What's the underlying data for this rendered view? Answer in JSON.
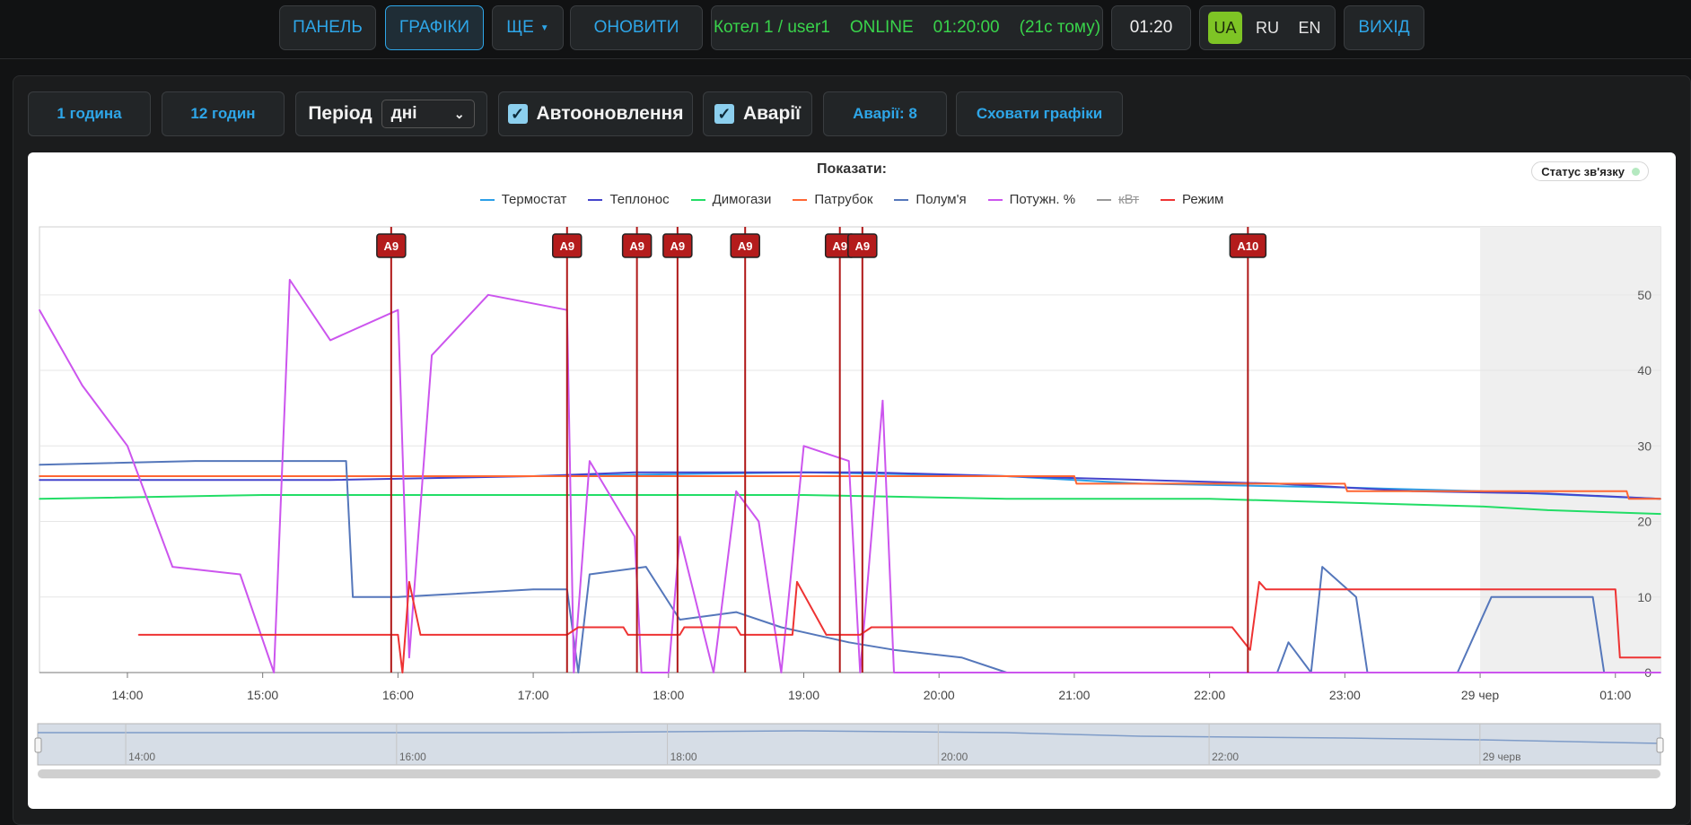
{
  "topbar": {
    "panel": "ПАНЕЛЬ",
    "charts": "ГРАФІКИ",
    "more": "ЩЕ",
    "refresh": "ОНОВИТИ",
    "status_device": "Котел 1 / user1",
    "status_state": "ONLINE",
    "status_time": "01:20:00",
    "status_ago": "(21с тому)",
    "clock": "01:20",
    "langs": [
      "UA",
      "RU",
      "EN"
    ],
    "active_lang": "UA",
    "exit": "ВИХІД"
  },
  "toolbar": {
    "one_hour": "1 година",
    "twelve_hours": "12 годин",
    "period_label": "Період",
    "period_value": "дні",
    "autorefresh": "Автооновлення",
    "alarms_toggle": "Аварії",
    "alarms_count": "Аварії: 8",
    "hide_charts": "Сховати графіки"
  },
  "chart_header": {
    "show": "Показати:",
    "link_status": "Статус зв'язку"
  },
  "chart_data": {
    "type": "line",
    "x_unit": "time",
    "xlim": [
      "13:21",
      "01:20"
    ],
    "ylim": [
      0,
      59
    ],
    "y_ticks": [
      0,
      10,
      20,
      30,
      40,
      50
    ],
    "x_ticks": [
      "14:00",
      "15:00",
      "16:00",
      "17:00",
      "18:00",
      "19:00",
      "20:00",
      "21:00",
      "22:00",
      "23:00",
      "29 чер",
      "01:00"
    ],
    "grid": true,
    "legend_position": "top-center",
    "shaded_region": [
      "00:00",
      "01:20"
    ],
    "series": [
      {
        "name": "Термостат",
        "color": "#2b9fe8",
        "visible": true,
        "points": [
          [
            "13:21",
            26
          ],
          [
            "15:30",
            26
          ],
          [
            "17:00",
            26
          ],
          [
            "19:00",
            26.5
          ],
          [
            "20:30",
            26
          ],
          [
            "21:30",
            25
          ],
          [
            "23:00",
            24.5
          ],
          [
            "00:00",
            24
          ],
          [
            "01:20",
            23
          ]
        ]
      },
      {
        "name": "Теплонос",
        "color": "#4444cc",
        "visible": true,
        "points": [
          [
            "13:21",
            25.5
          ],
          [
            "15:30",
            25.5
          ],
          [
            "17:00",
            26
          ],
          [
            "17:45",
            26.5
          ],
          [
            "19:30",
            26.5
          ],
          [
            "20:30",
            26
          ],
          [
            "21:30",
            25.5
          ],
          [
            "22:30",
            25
          ],
          [
            "23:30",
            24
          ],
          [
            "00:30",
            23.7
          ],
          [
            "01:20",
            23
          ]
        ]
      },
      {
        "name": "Димогази",
        "color": "#22dd66",
        "visible": true,
        "points": [
          [
            "13:21",
            23
          ],
          [
            "15:00",
            23.5
          ],
          [
            "17:00",
            23.5
          ],
          [
            "19:00",
            23.5
          ],
          [
            "20:30",
            23
          ],
          [
            "22:00",
            23
          ],
          [
            "23:00",
            22.5
          ],
          [
            "00:00",
            22
          ],
          [
            "00:30",
            21.5
          ],
          [
            "01:20",
            21
          ]
        ]
      },
      {
        "name": "Патрубок",
        "color": "#ff6633",
        "visible": true,
        "points": [
          [
            "13:21",
            26
          ],
          [
            "16:00",
            26
          ],
          [
            "19:00",
            26
          ],
          [
            "21:00",
            26
          ],
          [
            "21:01",
            25
          ],
          [
            "22:00",
            25
          ],
          [
            "23:00",
            25
          ],
          [
            "23:01",
            24
          ],
          [
            "00:30",
            24
          ],
          [
            "01:05",
            24
          ],
          [
            "01:06",
            23
          ],
          [
            "01:20",
            23
          ]
        ]
      },
      {
        "name": "Полум'я",
        "color": "#5577bb",
        "visible": true,
        "points": [
          [
            "13:21",
            27.5
          ],
          [
            "14:30",
            28
          ],
          [
            "15:37",
            28
          ],
          [
            "15:40",
            10
          ],
          [
            "16:00",
            10
          ],
          [
            "17:00",
            11
          ],
          [
            "17:15",
            11
          ],
          [
            "17:20",
            0
          ],
          [
            "17:25",
            13
          ],
          [
            "17:50",
            14
          ],
          [
            "18:05",
            7
          ],
          [
            "18:30",
            8
          ],
          [
            "18:50",
            6
          ],
          [
            "19:20",
            4
          ],
          [
            "19:40",
            3
          ],
          [
            "20:10",
            2
          ],
          [
            "20:30",
            0
          ],
          [
            "22:30",
            0
          ],
          [
            "22:35",
            4
          ],
          [
            "22:45",
            0
          ],
          [
            "22:50",
            14
          ],
          [
            "23:05",
            10
          ],
          [
            "23:10",
            0
          ],
          [
            "23:50",
            0
          ],
          [
            "00:05",
            10
          ],
          [
            "00:50",
            10
          ],
          [
            "00:55",
            0
          ],
          [
            "01:20",
            0
          ]
        ]
      },
      {
        "name": "Потужн. %",
        "color": "#cc55ee",
        "visible": true,
        "points": [
          [
            "13:21",
            48
          ],
          [
            "13:40",
            38
          ],
          [
            "14:00",
            30
          ],
          [
            "14:20",
            14
          ],
          [
            "14:50",
            13
          ],
          [
            "15:05",
            0
          ],
          [
            "15:12",
            52
          ],
          [
            "15:30",
            44
          ],
          [
            "16:00",
            48
          ],
          [
            "16:05",
            2
          ],
          [
            "16:15",
            42
          ],
          [
            "16:40",
            50
          ],
          [
            "17:15",
            48
          ],
          [
            "17:18",
            0
          ],
          [
            "17:25",
            28
          ],
          [
            "17:45",
            18
          ],
          [
            "17:48",
            0
          ],
          [
            "18:00",
            0
          ],
          [
            "18:05",
            18
          ],
          [
            "18:20",
            0
          ],
          [
            "18:30",
            24
          ],
          [
            "18:40",
            20
          ],
          [
            "18:50",
            0
          ],
          [
            "19:00",
            30
          ],
          [
            "19:20",
            28
          ],
          [
            "19:25",
            0
          ],
          [
            "19:35",
            36
          ],
          [
            "19:40",
            0
          ],
          [
            "20:00",
            0
          ],
          [
            "01:20",
            0
          ]
        ]
      },
      {
        "name": "кВт",
        "color": "#999999",
        "visible": false,
        "points": []
      },
      {
        "name": "Режим",
        "color": "#ee3333",
        "visible": true,
        "points": [
          [
            "14:05",
            5
          ],
          [
            "16:00",
            5
          ],
          [
            "16:02",
            0
          ],
          [
            "16:05",
            12
          ],
          [
            "16:10",
            5
          ],
          [
            "17:15",
            5
          ],
          [
            "17:20",
            6
          ],
          [
            "17:40",
            6
          ],
          [
            "17:42",
            5
          ],
          [
            "18:05",
            5
          ],
          [
            "18:07",
            6
          ],
          [
            "18:30",
            6
          ],
          [
            "18:32",
            5
          ],
          [
            "18:55",
            5
          ],
          [
            "18:57",
            12
          ],
          [
            "19:10",
            5
          ],
          [
            "19:25",
            5
          ],
          [
            "19:30",
            6
          ],
          [
            "22:10",
            6
          ],
          [
            "22:18",
            3
          ],
          [
            "22:22",
            12
          ],
          [
            "22:25",
            11
          ],
          [
            "01:00",
            11
          ],
          [
            "01:02",
            2
          ],
          [
            "01:20",
            2
          ]
        ]
      }
    ],
    "alarms": [
      {
        "label": "A9",
        "time": "15:57"
      },
      {
        "label": "A9",
        "time": "17:15"
      },
      {
        "label": "A9",
        "time": "17:46"
      },
      {
        "label": "A9",
        "time": "18:04"
      },
      {
        "label": "A9",
        "time": "18:34"
      },
      {
        "label": "A9",
        "time": "19:16"
      },
      {
        "label": "A9",
        "time": "19:26"
      },
      {
        "label": "A10",
        "time": "22:17"
      }
    ],
    "navigator_ticks": [
      "14:00",
      "16:00",
      "18:00",
      "20:00",
      "22:00",
      "29 черв"
    ]
  }
}
